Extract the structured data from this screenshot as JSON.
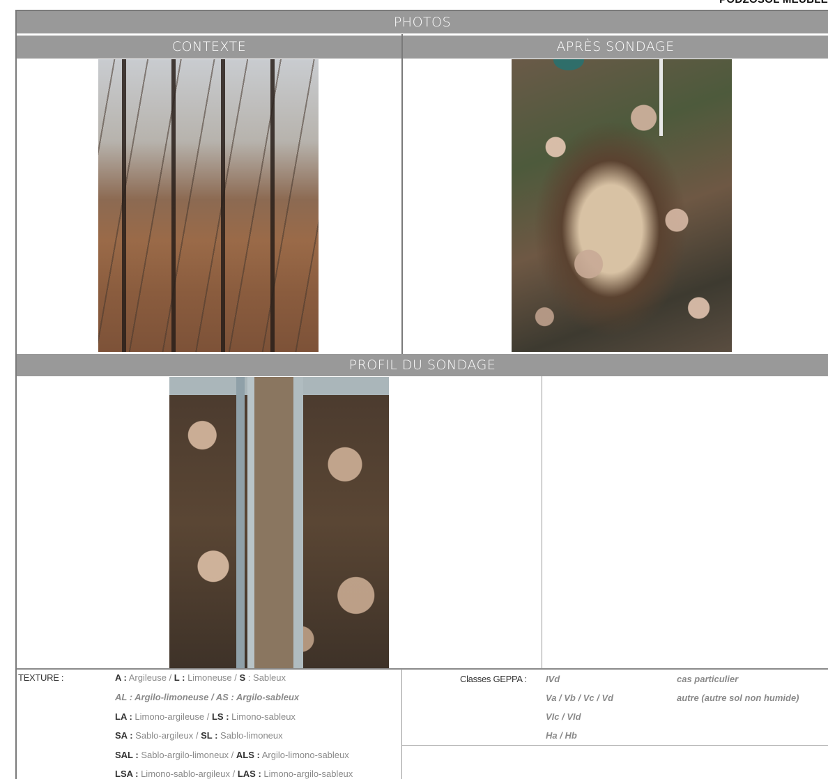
{
  "header": {
    "corner_title": "PODZOSOL MEUBLE"
  },
  "sections": {
    "photos": "PHOTOS",
    "context": "CONTEXTE",
    "after": "APRÈS SONDAGE",
    "profile": "PROFIL DU SONDAGE"
  },
  "texture": {
    "label": "TEXTURE :",
    "rows": [
      [
        {
          "code": "A :",
          "name": " Argileuse "
        },
        {
          "sep": " / "
        },
        {
          "code": "L :",
          "name": " Limoneuse"
        },
        {
          "sep": " / "
        },
        {
          "code": "S",
          "name": " : Sableux"
        }
      ],
      "AL  : Argilo-limoneuse / AS  : Argilo-sableux",
      [
        {
          "code": "LA :",
          "name": " Limono-argileuse"
        },
        {
          "sep": " / "
        },
        {
          "code": "LS  :",
          "name": " Limono-sableux"
        }
      ],
      [
        {
          "code": "SA :",
          "name": " Sablo-argileux"
        },
        {
          "sep": " / "
        },
        {
          "code": "SL  :",
          "name": " Sablo-limoneux"
        }
      ],
      [
        {
          "code": "SAL :",
          "name": " Sablo-argilo-limoneux "
        },
        {
          "sep": "  / "
        },
        {
          "code": "ALS :",
          "name": " Argilo-limono-sableux"
        }
      ],
      [
        {
          "code": "LSA :",
          "name": " Limono-sablo-argileux"
        },
        {
          "sep": " / "
        },
        {
          "code": "LAS :",
          "name": " Limono-argilo-sableux"
        }
      ]
    ]
  },
  "geppa": {
    "label": "Classes GEPPA :",
    "col1": [
      "IVd",
      "Va / Vb / Vc / Vd",
      "VIc / VId",
      "Ha / Hb"
    ],
    "col2": [
      "cas particulier",
      "autre (autre sol non humide)"
    ]
  }
}
